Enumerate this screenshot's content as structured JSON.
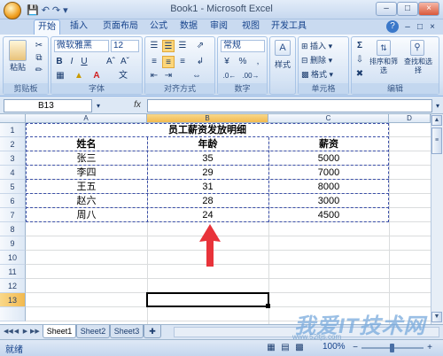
{
  "window": {
    "title": "Book1 - Microsoft Excel"
  },
  "ribbon_tabs": [
    "开始",
    "插入",
    "页面布局",
    "公式",
    "数据",
    "审阅",
    "视图",
    "开发工具"
  ],
  "ribbon": {
    "clipboard": {
      "paste_label": "粘贴",
      "group_label": "剪贴板"
    },
    "font": {
      "font_name": "微软雅黑",
      "font_size": "12",
      "group_label": "字体",
      "bold": "B",
      "italic": "I",
      "underline": "U"
    },
    "alignment": {
      "group_label": "对齐方式"
    },
    "number": {
      "format": "常规",
      "percent": "%",
      "comma": ",",
      "group_label": "数字"
    },
    "styles": {
      "label": "样式"
    },
    "cells": {
      "insert": "插入",
      "delete": "删除",
      "format": "格式",
      "group_label": "单元格"
    },
    "editing": {
      "sum": "Σ",
      "sort_filter": "排序和筛选",
      "find_select": "查找和选择",
      "group_label": "编辑"
    }
  },
  "formula_bar": {
    "name_box": "B13",
    "fx": "fx",
    "formula": ""
  },
  "columns": [
    "A",
    "B",
    "C",
    "D"
  ],
  "rows": [
    "1",
    "2",
    "3",
    "4",
    "5",
    "6",
    "7",
    "8",
    "9",
    "10",
    "11",
    "12",
    "13"
  ],
  "sheet": {
    "title": "员工薪资发放明细",
    "headers": [
      "姓名",
      "年龄",
      "薪资"
    ],
    "data": [
      [
        "张三",
        "35",
        "5000"
      ],
      [
        "李四",
        "29",
        "7000"
      ],
      [
        "王五",
        "31",
        "8000"
      ],
      [
        "赵六",
        "28",
        "3000"
      ],
      [
        "周八",
        "24",
        "4500"
      ]
    ]
  },
  "sheet_tabs": [
    "Sheet1",
    "Sheet2",
    "Sheet3"
  ],
  "status": {
    "mode": "就绪",
    "zoom": "100%"
  },
  "watermark": {
    "text": "我爱IT技术网",
    "sub": "www.52itjs.com"
  },
  "colors": {
    "accent": "#15428b",
    "arrow": "#e8333a",
    "selection_border": "#3b4fa8"
  }
}
